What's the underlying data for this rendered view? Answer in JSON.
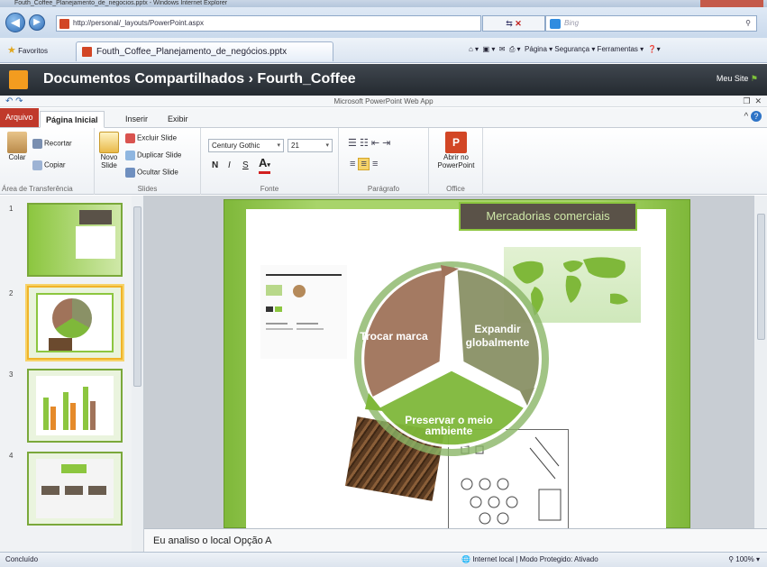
{
  "browser": {
    "window_title": "Fouth_Coffee_Planejamento_de_negocios.pptx - Windows Internet Explorer",
    "address": "http://personal/_layouts/PowerPoint.aspx",
    "search_placeholder": "Bing",
    "favorites_label": "Favoritos",
    "tab_title": "Fouth_Coffee_Planejamento_de_negócios.pptx",
    "command_bar": "Página ▾  Segurança ▾  Ferramentas ▾",
    "back_glyph": "◀",
    "forward_glyph": "▶"
  },
  "sharepoint": {
    "breadcrumb": "Documentos Compartilhados  ›  Fourth_Coffee",
    "my_site": "Meu Site"
  },
  "app": {
    "title": "Microsoft PowerPoint Web App"
  },
  "ribbon": {
    "tabs": {
      "file": "Arquivo",
      "home": "Página Inicial",
      "insert": "Inserir",
      "view": "Exibir"
    },
    "clipboard": {
      "paste": "Colar",
      "cut": "Recortar",
      "copy": "Copiar",
      "label": "Área de Transferência"
    },
    "slides": {
      "new_slide": "Novo Slide",
      "delete": "Excluir Slide",
      "duplicate": "Duplicar Slide",
      "hide": "Ocultar Slide",
      "label": "Slides"
    },
    "font": {
      "family": "Century Gothic",
      "size": "21",
      "bold": "N",
      "italic": "I",
      "underline": "S",
      "label": "Fonte"
    },
    "paragraph": {
      "label": "Parágrafo"
    },
    "office": {
      "open": "Abrir no PowerPoint",
      "label": "Office"
    }
  },
  "thumbnails": [
    {
      "num": "1"
    },
    {
      "num": "2",
      "selected": true
    },
    {
      "num": "3"
    },
    {
      "num": "4"
    }
  ],
  "slide": {
    "title": "Mercadorias comerciais",
    "segments": [
      "Trocar marca",
      "Expandir globalmente",
      "Preservar o meio ambiente"
    ],
    "colors": {
      "brown": "#a0735a",
      "olive": "#8a9166",
      "green": "#7fb83a",
      "frame": "#8cc63f",
      "titlebox": "#5a5248"
    }
  },
  "notes": "Eu analiso o local Opção A",
  "status": {
    "left": "Concluído",
    "zone": "Internet local | Modo Protegido: Ativado",
    "zoom": "100%"
  }
}
